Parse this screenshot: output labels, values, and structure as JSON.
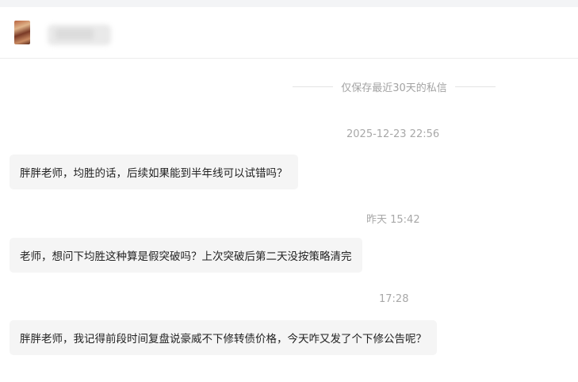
{
  "chat": {
    "notice": "仅保存最近30天的私信",
    "messages": [
      {
        "time": "2025-12-23 22:56",
        "text": "胖胖老师，均胜的话，后续如果能到半年线可以试错吗？"
      },
      {
        "time": "昨天 15:42",
        "text": "老师，想问下均胜这种算是假突破吗？上次突破后第二天没按策略清完"
      },
      {
        "time": "17:28",
        "text": "胖胖老师，我记得前段时间复盘说豪威不下修转债价格，今天咋又发了个下修公告呢？"
      }
    ]
  },
  "colors": {
    "bubble_bg": "#f5f5f5",
    "meta_text": "#a8a8a8",
    "message_text": "#222222"
  }
}
